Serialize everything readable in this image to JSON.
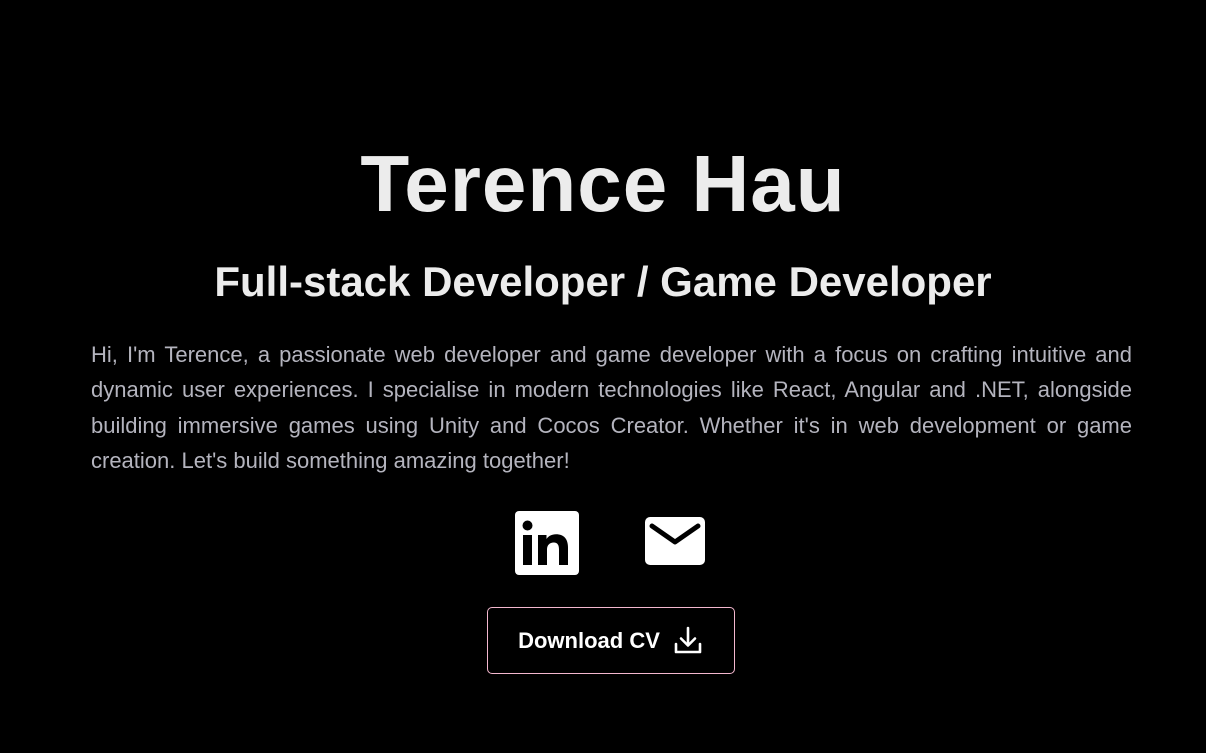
{
  "hero": {
    "name": "Terence Hau",
    "role": "Full-stack Developer / Game Developer",
    "bio": "Hi, I'm Terence, a passionate web developer and game developer with a focus on crafting intuitive and dynamic user experiences. I specialise in modern technologies like React, Angular and .NET, alongside building immersive games using Unity and Cocos Creator. Whether it's in web development or game creation. Let's build something amazing together!"
  },
  "socials": [
    {
      "icon": "linkedin-icon"
    },
    {
      "icon": "mail-icon"
    }
  ],
  "cv_button": {
    "label": "Download CV",
    "icon": "download-icon"
  },
  "colors": {
    "background": "#000000",
    "heading": "#ececec",
    "body_text": "#b4b4be",
    "button_border": "#f4b8cf",
    "icon": "#ffffff"
  }
}
